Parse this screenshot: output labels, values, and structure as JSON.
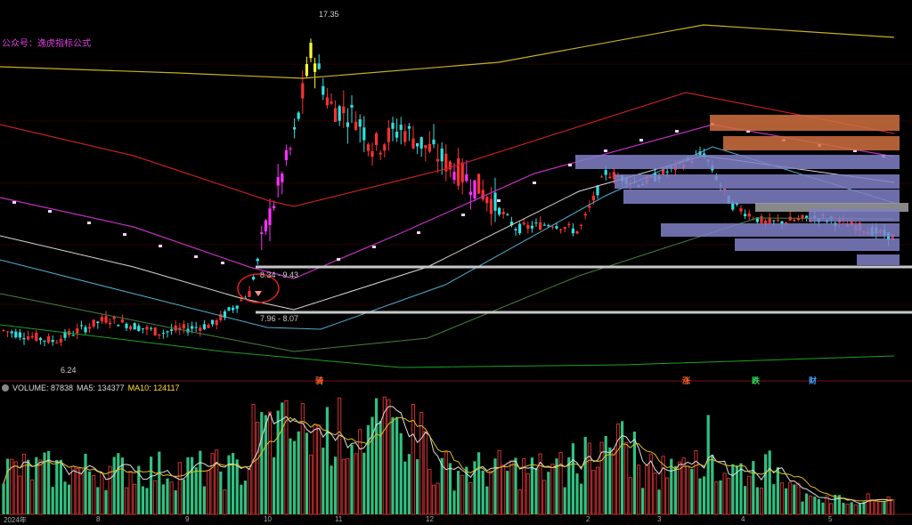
{
  "header": {
    "formula_label": "公众号：逸虎指标公式"
  },
  "annotations": {
    "high_price": "17.35",
    "low_price": "6.24",
    "zone_upper": "8.34 - 9.43",
    "zone_lower": "7.96 - 8.07"
  },
  "signals": [
    {
      "label": "骑",
      "color": "#ff6030"
    },
    {
      "label": "涨",
      "color": "#ff6030"
    },
    {
      "label": "跌",
      "color": "#30e060"
    },
    {
      "label": "财",
      "color": "#40a0ff"
    }
  ],
  "volume_legend": {
    "volume": "VOLUME: 87838",
    "ma5": "MA5: 134377",
    "ma10": "MA10: 124117"
  },
  "month_labels": [
    "2024年",
    "8",
    "9",
    "10",
    "11",
    "12",
    "2",
    "3",
    "4",
    "5"
  ],
  "colors": {
    "up": "#ff3030",
    "down": "#30e0e0",
    "surge": "#ff30ff",
    "peak": "#ffff30",
    "vol_up": "#d03030",
    "vol_down": "#30c080",
    "band_blue": "#8080c8",
    "band_orange": "#d07040"
  },
  "chart_data": {
    "type": "candlestick",
    "price_range": [
      5.5,
      18.5
    ],
    "high": 17.35,
    "low": 6.24,
    "support_zones": [
      [
        8.34,
        9.43
      ],
      [
        7.96,
        8.07
      ]
    ],
    "key_points": [
      {
        "phase": "base",
        "price": 7.2
      },
      {
        "phase": "breakout",
        "price": 8.3
      },
      {
        "phase": "peak",
        "price": 17.35
      },
      {
        "phase": "pullback",
        "price": 13.5
      },
      {
        "phase": "low-rebound",
        "price": 10.5
      },
      {
        "phase": "second-high",
        "price": 13.3
      },
      {
        "phase": "consolidation",
        "price": 10.8
      }
    ],
    "volume": {
      "latest": 87838,
      "ma5": 134377,
      "ma10": 124117
    }
  }
}
